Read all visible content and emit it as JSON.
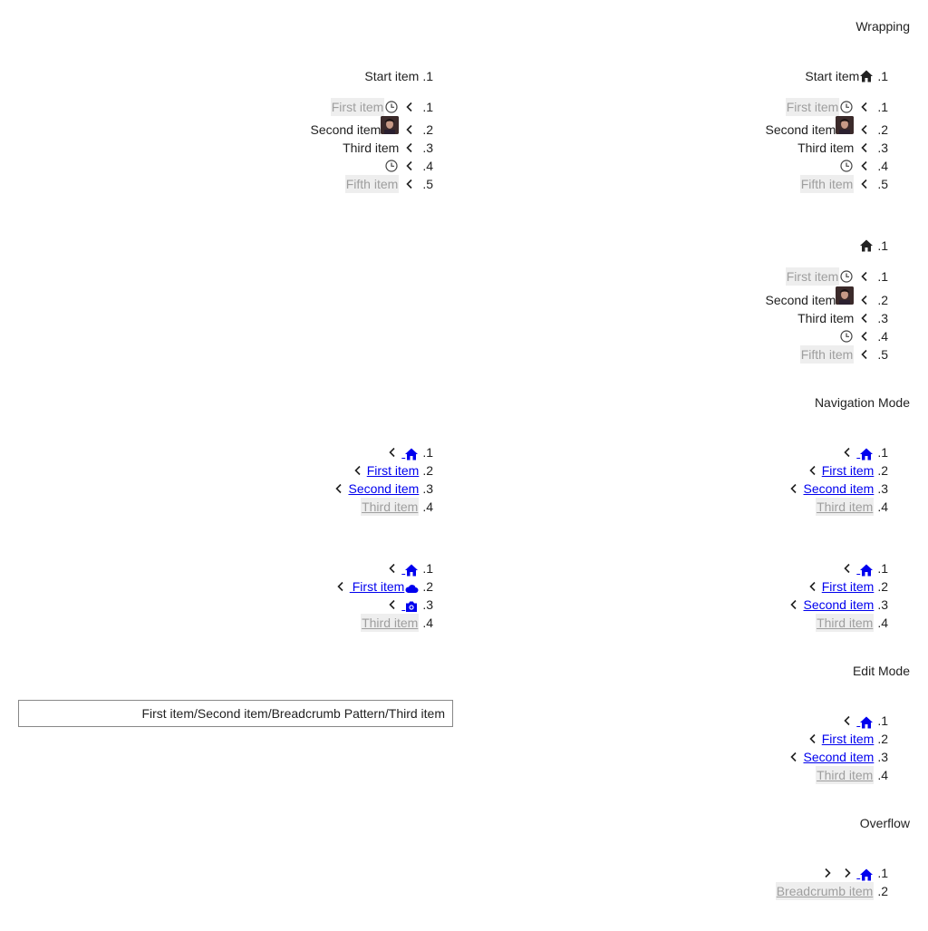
{
  "sections": {
    "wrapping": "Wrapping",
    "navigation": "Navigation Mode",
    "edit": "Edit Mode",
    "overflow": "Overflow"
  },
  "numbers": {
    "n1": ".1",
    "n2": ".2",
    "n3": ".3",
    "n4": ".4",
    "n5": ".5"
  },
  "wrap": {
    "start_item": "Start item",
    "first_item": "First item",
    "second_item": "Second item",
    "third_item": "Third item",
    "fifth_item": "Fifth item"
  },
  "nav": {
    "first_item": "First item",
    "second_item": "Second item",
    "third_item": "Third item"
  },
  "edit": {
    "path_value": "First item/Second item/Breadcrumb Pattern/Third item"
  },
  "overflow": {
    "breadcrumb_item": "Breadcrumb item"
  },
  "colors": {
    "link": "#0000ee",
    "current_bg": "#eeeeee",
    "muted_text": "#9e9e9e"
  },
  "icons": {
    "home": "home-icon",
    "clock": "clock-icon",
    "chevron": "chevron-left-icon",
    "cloud": "cloud-icon",
    "camera": "camera-icon",
    "overflow": "chevron-right-icon"
  }
}
